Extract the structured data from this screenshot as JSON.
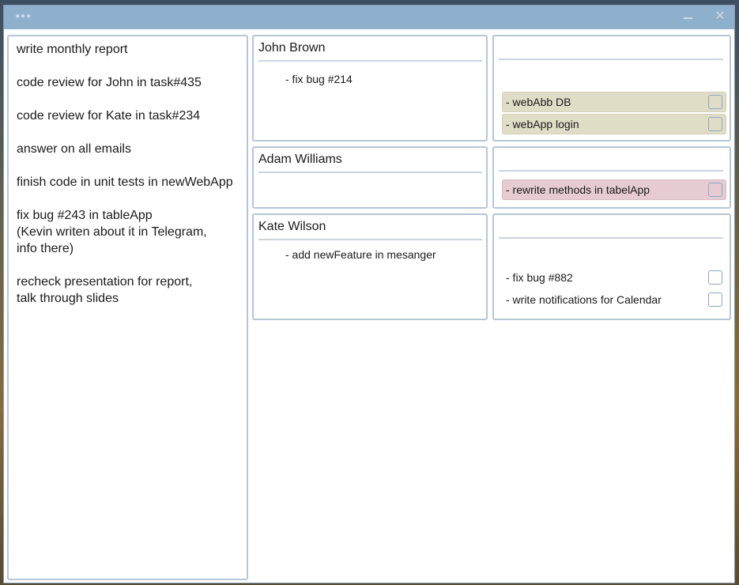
{
  "todo": {
    "items": [
      "write monthly report",
      "code review for John in task#435",
      "code review for Kate in task#234",
      "answer on all emails",
      "finish code in unit tests in newWebApp",
      "fix bug #243 in tableApp\n(Kevin writen about it in Telegram,\ninfo there)",
      "recheck presentation for report,\ntalk through slides"
    ]
  },
  "people": [
    {
      "name": "John Brown",
      "task": "- fix bug #214"
    },
    {
      "name": "Adam Williams",
      "task": ""
    },
    {
      "name": "Kate Wilson",
      "task": "- add newFeature in mesanger"
    }
  ],
  "task_groups": [
    {
      "tasks": [
        {
          "label": "- webAbb DB",
          "status": "done",
          "checked": false
        },
        {
          "label": "- webApp login",
          "status": "done",
          "checked": false
        }
      ]
    },
    {
      "tasks": [
        {
          "label": "- rewrite methods in tabelApp",
          "status": "blocked",
          "checked": false
        }
      ]
    },
    {
      "tasks": [
        {
          "label": "- fix bug #882",
          "status": "plain",
          "checked": false
        },
        {
          "label": "- write notifications for Calendar",
          "status": "plain",
          "checked": false
        }
      ]
    }
  ],
  "colors": {
    "done": "#e0ddc7",
    "blocked": "#e6ccd2",
    "titlebar": "#8fb0cc"
  }
}
